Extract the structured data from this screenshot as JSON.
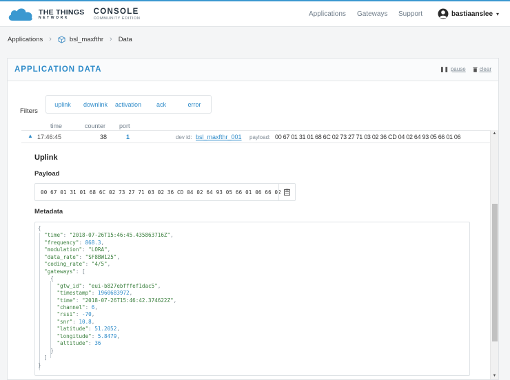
{
  "header": {
    "brand_line1": "THE THINGS",
    "brand_line2": "NETWORK",
    "console_title": "CONSOLE",
    "console_subtitle": "COMMUNITY EDITION",
    "nav": [
      "Applications",
      "Gateways",
      "Support"
    ],
    "username": "bastiaanslee"
  },
  "breadcrumb": {
    "items": [
      "Applications",
      "bsl_maxfthr",
      "Data"
    ]
  },
  "panel": {
    "title": "APPLICATION DATA",
    "pause_label": "pause",
    "clear_label": "clear"
  },
  "filters": {
    "label": "Filters",
    "options": [
      "uplink",
      "downlink",
      "activation",
      "ack",
      "error"
    ]
  },
  "table": {
    "columns": [
      "time",
      "counter",
      "port"
    ],
    "row": {
      "time": "17:46:45",
      "counter": "38",
      "port": "1",
      "dev_id_label": "dev id:",
      "dev_id": "bsl_maxfthr_001",
      "payload_label": "payload:",
      "payload": "00 67 01 31 01 68 6C 02 73 27 71 03 02 36 CD 04 02 64 93 05 66 01 06"
    }
  },
  "detail": {
    "title": "Uplink",
    "payload_label": "Payload",
    "payload": "00 67 01 31 01 68 6C 02 73 27 71 03 02 36 CD 04 02 64 93 05 66 01 06 66 02",
    "metadata_label": "Metadata",
    "metadata": {
      "time": "2018-07-26T15:46:45.435863716Z",
      "frequency": "868.3",
      "modulation": "LORA",
      "data_rate": "SF8BW125",
      "coding_rate": "4/5",
      "gateway": {
        "gtw_id": "eui-b827ebfffef1dac5",
        "timestamp": "1960683972",
        "time": "2018-07-26T15:46:42.374622Z",
        "channel": "6",
        "rssi": "-70",
        "snr": "10.8",
        "latitude": "51.2052",
        "longitude": "5.8479",
        "altitude": "36"
      }
    }
  },
  "colors": {
    "accent": "#2e8bc9",
    "json_key": "#3a7f3d"
  }
}
